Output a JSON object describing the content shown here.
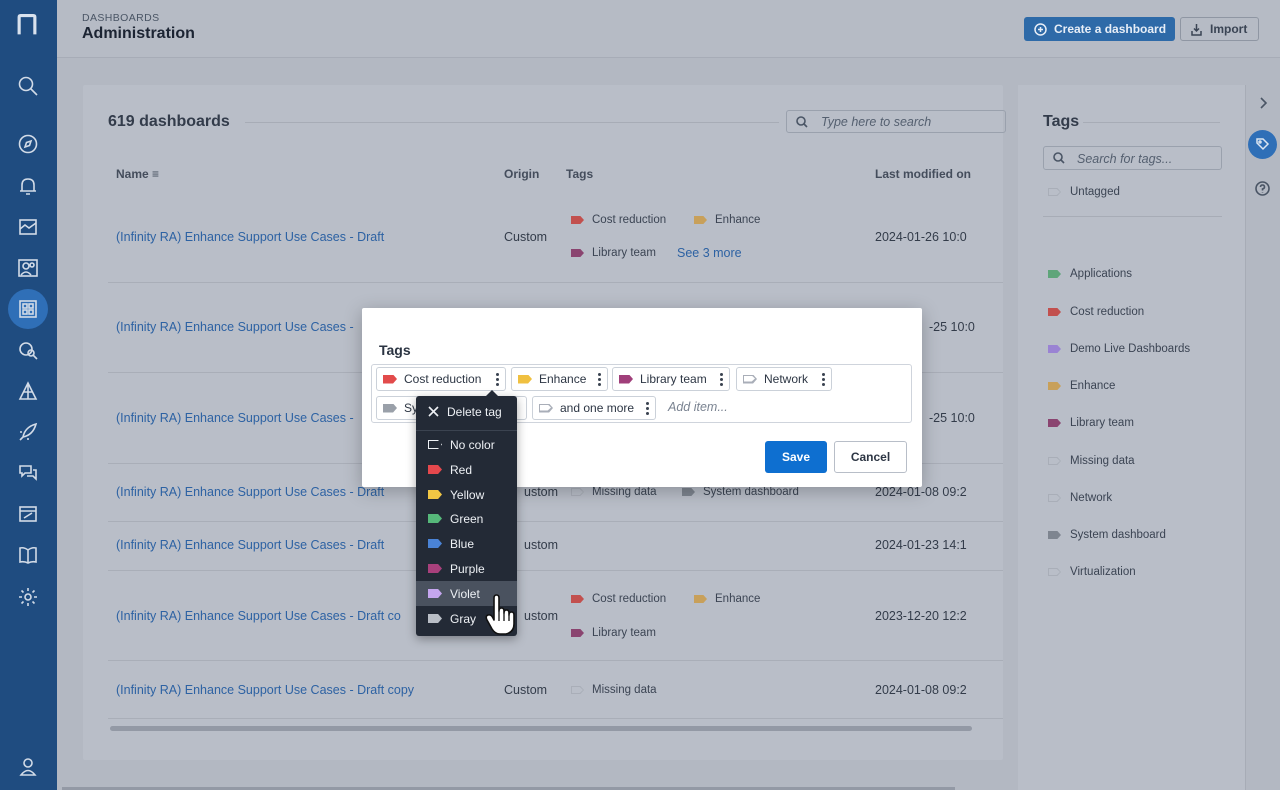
{
  "header": {
    "breadcrumb": "DASHBOARDS",
    "title": "Administration",
    "create_label": "Create a dashboard",
    "import_label": "Import"
  },
  "nav": {
    "items": [
      "search-icon",
      "explore-icon",
      "notifications-icon",
      "analytics-icon",
      "users-icon",
      "dashboards-icon",
      "investigate-icon",
      "apps-icon",
      "rocket-icon",
      "chat-icon",
      "reports-icon",
      "docs-icon",
      "settings-icon",
      "profile-icon"
    ],
    "active": "dashboards-icon"
  },
  "list": {
    "count": "619 dashboards",
    "search_placeholder": "Type here to search",
    "columns": {
      "name": "Name",
      "origin": "Origin",
      "tags": "Tags",
      "modified": "Last modified on"
    },
    "rows": [
      {
        "name": "(Infinity RA) Enhance Support Use Cases - Draft",
        "origin": "Custom",
        "date": "2024-01-26 10:0",
        "tags": [
          "Cost reduction",
          "Enhance",
          "Library team"
        ],
        "see_more": "See 3 more"
      },
      {
        "name": "(Infinity RA) Enhance Support Use Cases - ",
        "origin": "",
        "date": "-25 10:0",
        "tags": []
      },
      {
        "name": "(Infinity RA) Enhance Support Use Cases - ",
        "origin": "",
        "date": "-25 10:0",
        "tags": []
      },
      {
        "name": "(Infinity RA) Enhance Support Use Cases - Draft",
        "origin": "ustom",
        "date": "2024-01-08 09:2",
        "tags": [
          "Missing data",
          "System dashboard"
        ]
      },
      {
        "name": "(Infinity RA) Enhance Support Use Cases - Draft",
        "origin": "ustom",
        "date": "2024-01-23 14:1",
        "tags": []
      },
      {
        "name": "(Infinity RA) Enhance Support Use Cases - Draft co",
        "origin": "ustom",
        "date": "2023-12-20 12:2",
        "tags": [
          "Cost reduction",
          "Enhance",
          "Library team"
        ]
      },
      {
        "name": "(Infinity RA) Enhance Support Use Cases - Draft copy",
        "origin": "Custom",
        "date": "2024-01-08 09:2",
        "tags": [
          "Missing data"
        ]
      }
    ]
  },
  "tags_panel": {
    "title": "Tags",
    "search_placeholder": "Search for tags...",
    "untagged": "Untagged",
    "tags": [
      {
        "name": "Applications",
        "color": "#5fa57a"
      },
      {
        "name": "Cost reduction",
        "color": "#c2504e"
      },
      {
        "name": "Demo Live Dashboards",
        "color": "#9a83d3"
      },
      {
        "name": "Enhance",
        "color": "#c8a05a"
      },
      {
        "name": "Library team",
        "color": "#8a4470"
      },
      {
        "name": "Missing data",
        "color": "outline"
      },
      {
        "name": "Network",
        "color": "outline"
      },
      {
        "name": "System dashboard",
        "color": "#7e8590"
      },
      {
        "name": "Virtualization",
        "color": "outline"
      }
    ]
  },
  "modal": {
    "title": "Tags",
    "chips": [
      {
        "label": "Cost reduction",
        "color": "#e24b4b"
      },
      {
        "label": "Enhance",
        "color": "#f0c040"
      },
      {
        "label": "Library team",
        "color": "#a03f7a"
      },
      {
        "label": "Network",
        "color": "outline"
      },
      {
        "label": "Sy",
        "color": "#9aa0a9"
      },
      {
        "label": "and one more",
        "color": "outline"
      }
    ],
    "add_placeholder": "Add item...",
    "save_label": "Save",
    "cancel_label": "Cancel"
  },
  "menu": {
    "delete_label": "Delete tag",
    "colors": [
      {
        "label": "No color",
        "color": "outline"
      },
      {
        "label": "Red",
        "color": "#e5484d"
      },
      {
        "label": "Yellow",
        "color": "#f2c744"
      },
      {
        "label": "Green",
        "color": "#56b87a"
      },
      {
        "label": "Blue",
        "color": "#4a83d6"
      },
      {
        "label": "Purple",
        "color": "#a8407c"
      },
      {
        "label": "Violet",
        "color": "#c5a6ef"
      },
      {
        "label": "Gray",
        "color": "#b9bec6"
      }
    ],
    "hovered": "Violet"
  }
}
